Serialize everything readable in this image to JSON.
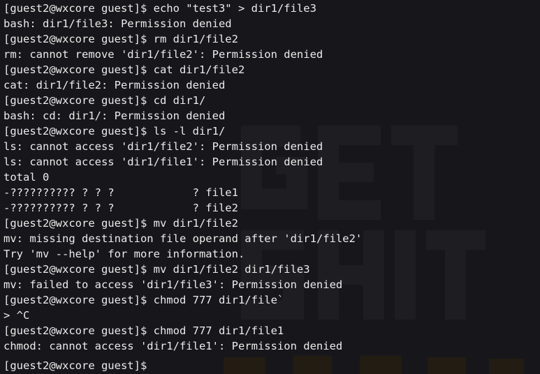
{
  "terminal": {
    "lines": [
      "[guest2@wxcore guest]$ echo \"test3\" > dir1/file3",
      "bash: dir1/file3: Permission denied",
      "[guest2@wxcore guest]$ rm dir1/file2",
      "rm: cannot remove 'dir1/file2': Permission denied",
      "[guest2@wxcore guest]$ cat dir1/file2",
      "cat: dir1/file2: Permission denied",
      "[guest2@wxcore guest]$ cd dir1/",
      "bash: cd: dir1/: Permission denied",
      "[guest2@wxcore guest]$ ls -l dir1/",
      "ls: cannot access 'dir1/file2': Permission denied",
      "ls: cannot access 'dir1/file1': Permission denied",
      "total 0",
      "-?????????? ? ? ?            ? file1",
      "-?????????? ? ? ?            ? file2",
      "[guest2@wxcore guest]$ mv dir1/file2",
      "mv: missing destination file operand after 'dir1/file2'",
      "Try 'mv --help' for more information.",
      "[guest2@wxcore guest]$ mv dir1/file2 dir1/file3",
      "mv: failed to access 'dir1/file3': Permission denied",
      "[guest2@wxcore guest]$ chmod 777 dir1/file`",
      "> ^C",
      "[guest2@wxcore guest]$ chmod 777 dir1/file1",
      "chmod: cannot access 'dir1/file1': Permission denied",
      "[guest2@wxcore guest]$ "
    ]
  },
  "colors": {
    "background": "#17171b",
    "text": "#ebebeb"
  }
}
